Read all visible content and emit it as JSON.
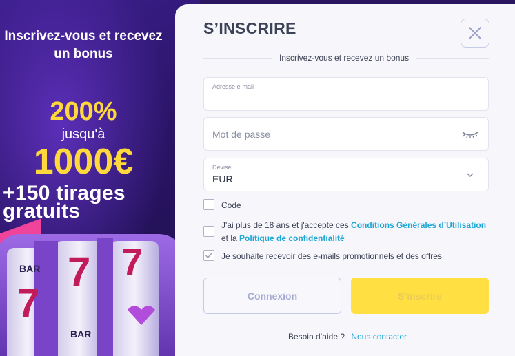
{
  "promo": {
    "title": "Inscrivez-vous et recevez un bonus",
    "percent": "200%",
    "upto": "jusqu'à",
    "amount": "1000€",
    "spins": "+150 tirages gratuits"
  },
  "modal": {
    "title": "S’INSCRIRE",
    "subtitle": "Inscrivez-vous et recevez un bonus",
    "email": {
      "label": "Adresse e-mail",
      "value": ""
    },
    "password": {
      "placeholder": "Mot de passe",
      "icon": "eye-closed-icon"
    },
    "currency": {
      "label": "Devise",
      "value": "EUR",
      "icon": "chevron-down-icon"
    },
    "code": {
      "label": "Code",
      "checked": false
    },
    "terms": {
      "prefix": "J'ai plus de 18 ans et j'accepte ces",
      "link1": "Conditions Générales d’Utilisation",
      "middle": "et la",
      "link2": "Politique de confidentialité",
      "checked": false
    },
    "newsletter": {
      "label": "Je souhaite recevoir des e-mails promotionnels et des offres",
      "checked": true
    },
    "login_button": "Connexion",
    "signup_button": "S’inscrire",
    "help_text": "Besoin d’aide ?",
    "help_link": "Nous contacter"
  },
  "colors": {
    "accent_yellow": "#ffd93b",
    "link_blue": "#1fa8d6",
    "promo_purple": "#3b1e8a"
  }
}
